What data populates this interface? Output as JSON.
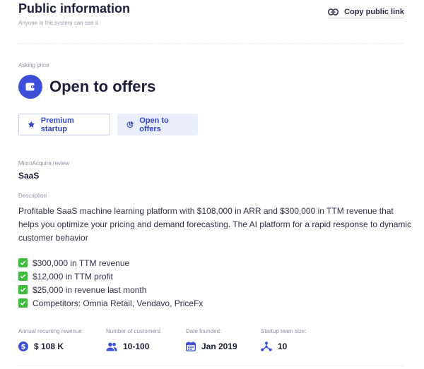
{
  "header": {
    "title": "Public information",
    "subtitle": "Anyone in the system can see it",
    "copy_link_label": "Copy public link",
    "copy_link_icon": "link-icon"
  },
  "asking_price": {
    "label": "Asking price",
    "value": "Open to offers",
    "icon": "wallet-icon"
  },
  "badges": {
    "premium_label": "Premium startup",
    "premium_icon": "star-icon",
    "offers_label": "Open to offers",
    "offers_icon": "pie-chart-icon"
  },
  "review": {
    "label": "MicroAcquire review",
    "value": "SaaS"
  },
  "description": {
    "label": "Description",
    "text": "Profitable SaaS machine learning platform with $108,000 in ARR and $300,000 in TTM revenue that helps you optimize your pricing and demand forecasting. The AI platform for a rapid response to dynamic customer behavior",
    "highlights": [
      "$300,000 in TTM revenue",
      "$12,000 in TTM profit",
      "$25,000 in revenue last month",
      "Competitors: Omnia Retail, Vendavo, PriceFx"
    ]
  },
  "stats": {
    "arr_label": "Annual recurring revenue:",
    "arr_value": "$ 108 K",
    "customers_label": "Number of customers:",
    "customers_value": "10-100",
    "founded_label": "Date founded:",
    "founded_value": "Jan 2019",
    "team_label": "Startup team size:",
    "team_value": "10"
  },
  "colors": {
    "accent": "#3d4fd8",
    "check_green": "#3dbb3a",
    "soft_button_bg": "#eaedfb"
  }
}
